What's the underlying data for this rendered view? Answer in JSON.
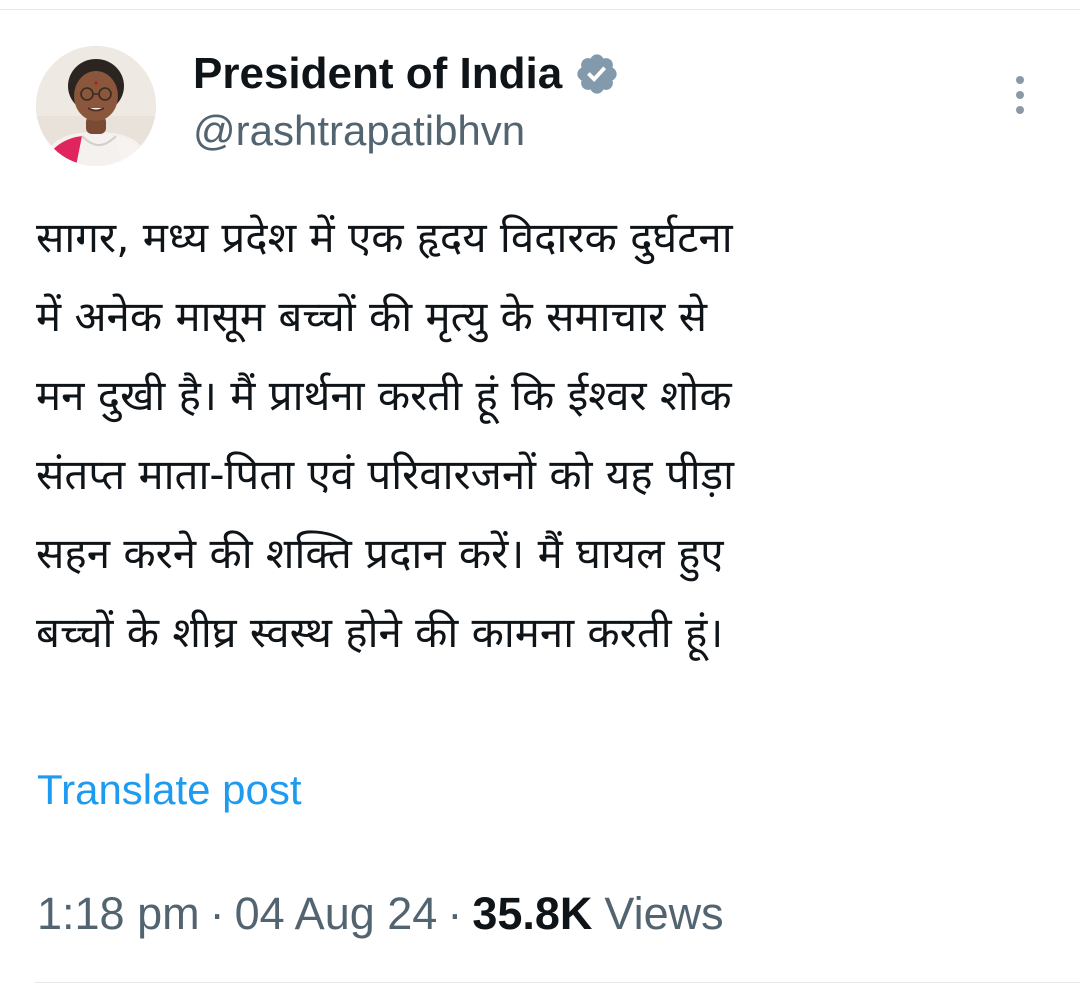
{
  "post": {
    "author": {
      "display_name": "President of India",
      "handle": "@rashtrapatibhvn",
      "verified_badge_icon": "verified-gray-badge-icon",
      "avatar": "profile-photo"
    },
    "body_lines": [
      "सागर, मध्य प्रदेश में एक हृदय विदारक दुर्घटना",
      "में अनेक मासूम बच्चों की मृत्यु के समाचार से",
      "मन दुखी है। मैं प्रार्थना करती हूं कि ईश्वर शोक",
      "संतप्त माता-पिता एवं परिवारजनों को यह पीड़ा",
      "सहन करने की शक्ति प्रदान करें। मैं घायल हुए",
      "बच्चों के शीघ्र स्वस्थ होने की कामना करती हूं।"
    ],
    "translate_label": "Translate post",
    "time": "1:18 pm",
    "separator": "·",
    "date": "04 Aug 24",
    "views_count": "35.8K",
    "views_label": "Views",
    "more_icon": "more-vertical-icon"
  },
  "colors": {
    "text_primary": "#0f1419",
    "text_secondary": "#536471",
    "link": "#1d9bf0",
    "badge": "#829aab",
    "divider": "#e6e9ec"
  }
}
